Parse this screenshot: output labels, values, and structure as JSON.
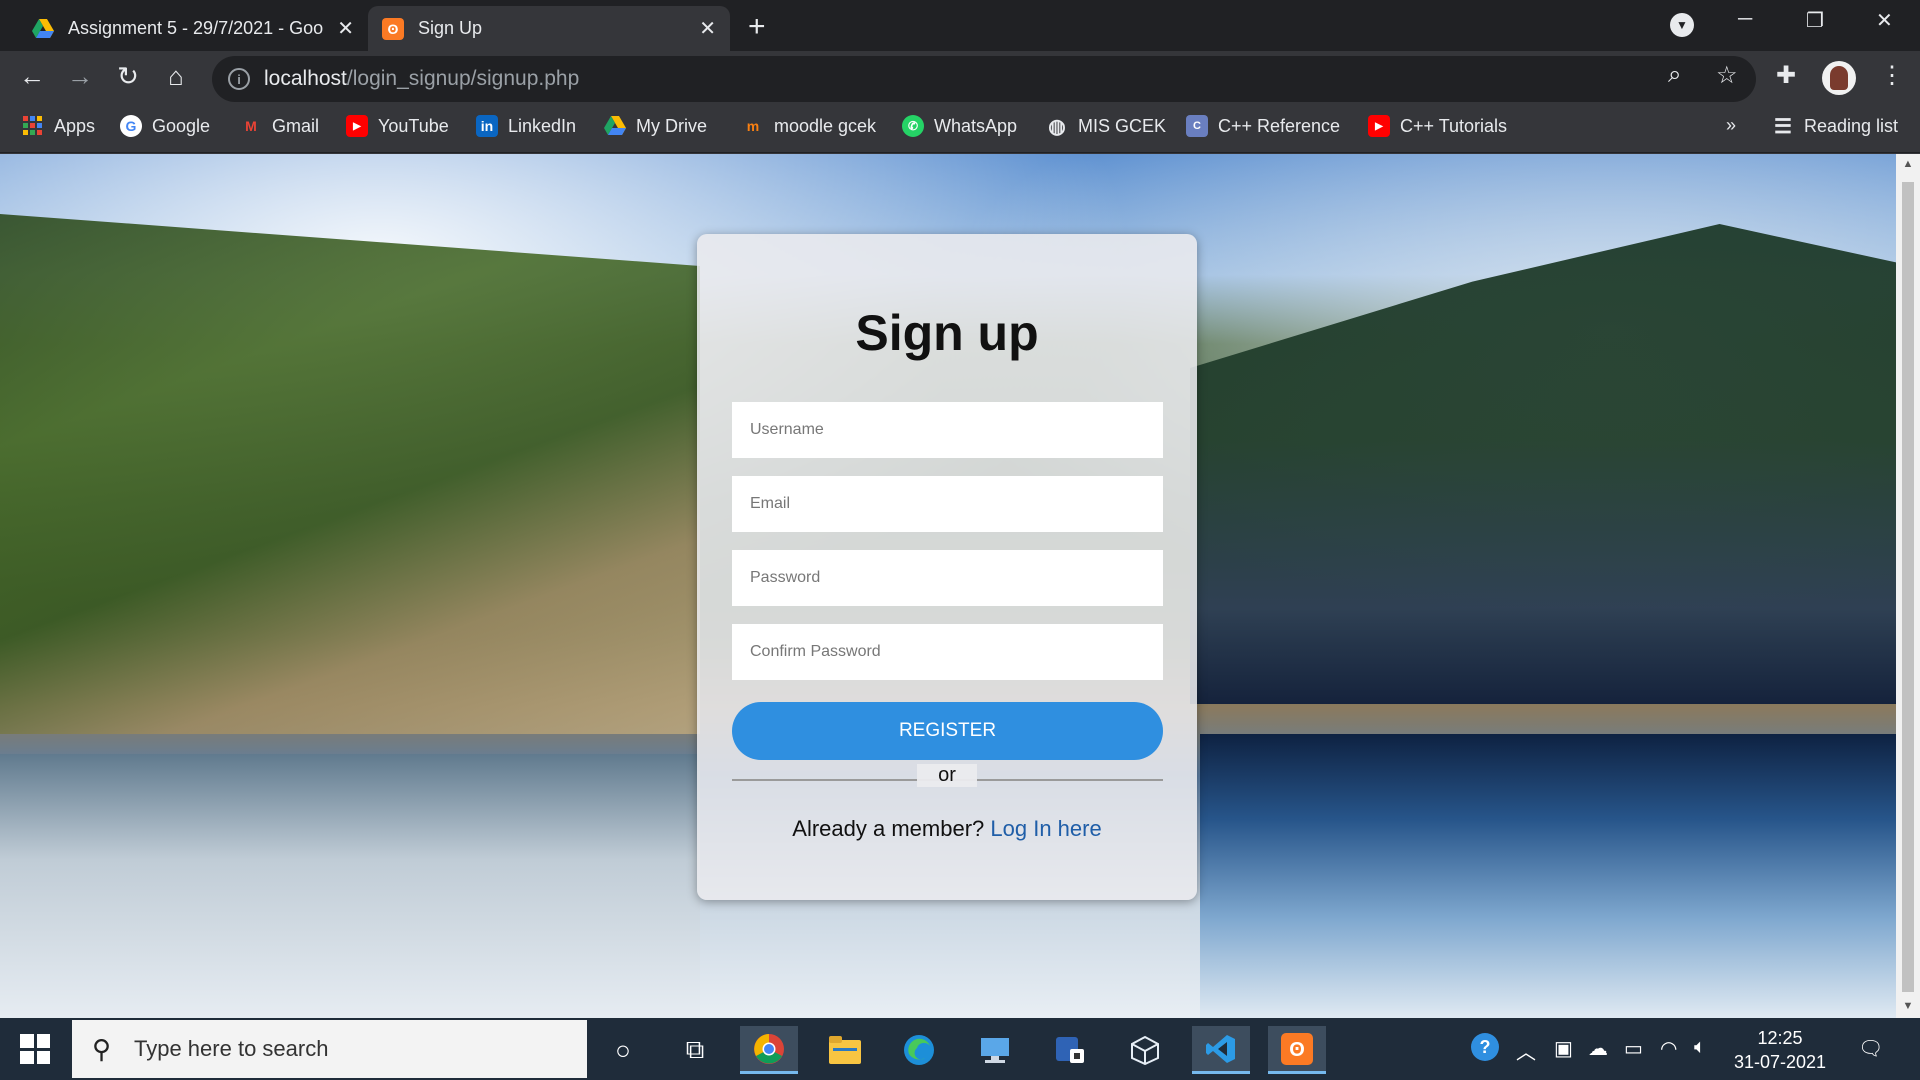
{
  "browser": {
    "tabs": [
      {
        "title": "Assignment 5 - 29/7/2021 - Goo",
        "active": false,
        "favicon": "google-drive-icon"
      },
      {
        "title": "Sign Up",
        "active": true,
        "favicon": "xampp-icon"
      }
    ],
    "new_tab": "+",
    "url_host": "localhost",
    "url_path": "/login_signup/signup.php",
    "bookmarks": [
      {
        "label": "Apps",
        "icon": "apps-grid-icon"
      },
      {
        "label": "Google",
        "icon": "google-icon"
      },
      {
        "label": "Gmail",
        "icon": "gmail-icon"
      },
      {
        "label": "YouTube",
        "icon": "youtube-icon"
      },
      {
        "label": "LinkedIn",
        "icon": "linkedin-icon"
      },
      {
        "label": "My Drive",
        "icon": "google-drive-icon"
      },
      {
        "label": "moodle gcek",
        "icon": "moodle-icon"
      },
      {
        "label": "WhatsApp",
        "icon": "whatsapp-icon"
      },
      {
        "label": "MIS GCEK",
        "icon": "globe-icon"
      },
      {
        "label": "C++ Reference",
        "icon": "cpp-reference-icon"
      },
      {
        "label": "C++ Tutorials",
        "icon": "youtube-icon"
      }
    ],
    "more_bookmarks": "»",
    "reading_list": "Reading list"
  },
  "form": {
    "title": "Sign up",
    "username_placeholder": "Username",
    "email_placeholder": "Email",
    "password_placeholder": "Password",
    "confirm_placeholder": "Confirm Password",
    "register_label": "REGISTER",
    "or_label": "or",
    "member_text": "Already a member? ",
    "login_link": "Log In here"
  },
  "taskbar": {
    "search_placeholder": "Type here to search",
    "time": "12:25",
    "date": "31-07-2021"
  },
  "colors": {
    "register_button": "#2f8fe0",
    "login_link": "#1f5ea8",
    "browser_frame": "#202124",
    "taskbar": "#1f2c3a"
  }
}
